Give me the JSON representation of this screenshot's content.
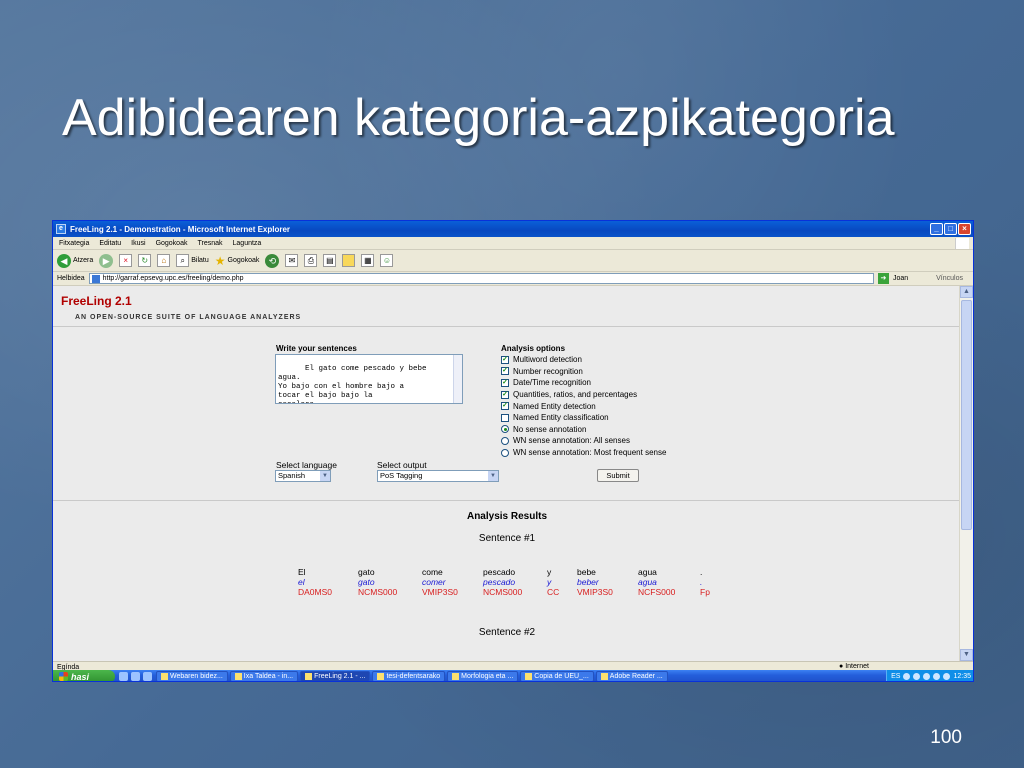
{
  "slide": {
    "title": "Adibidearen kategoria-azpikategoria",
    "number": "100"
  },
  "window": {
    "title": "FreeLing 2.1 - Demonstration - Microsoft Internet Explorer",
    "menu": [
      "Fitxategia",
      "Editatu",
      "Ikusi",
      "Gogokoak",
      "Tresnak",
      "Laguntza"
    ],
    "toolbar": {
      "back": "Atzera",
      "search": "Bilatu",
      "favorites": "Gogokoak"
    },
    "address": {
      "label": "Helbidea",
      "url": "http://garraf.epsevg.upc.es/freeling/demo.php",
      "go": "Joan",
      "links": "Vínculos"
    },
    "status": {
      "left": "Egínda",
      "zone": "Internet"
    }
  },
  "page": {
    "brand": "FreeLing 2.1",
    "subtitle": "AN OPEN-SOURCE SUITE OF LANGUAGE ANALYZERS",
    "sentences_label": "Write your sentences",
    "sentences_text": "El gato come pescado y bebe\nagua.\nYo bajo con el hombre bajo a\ntocar el bajo bajo la\nescalera.",
    "options_label": "Analysis options",
    "options": [
      {
        "type": "checkbox",
        "checked": true,
        "label": "Multiword detection"
      },
      {
        "type": "checkbox",
        "checked": true,
        "label": "Number recognition"
      },
      {
        "type": "checkbox",
        "checked": true,
        "label": "Date/Time recognition"
      },
      {
        "type": "checkbox",
        "checked": true,
        "label": "Quantities, ratios, and percentages"
      },
      {
        "type": "checkbox",
        "checked": true,
        "label": "Named Entity detection"
      },
      {
        "type": "checkbox",
        "checked": false,
        "label": "Named Entity classification"
      },
      {
        "type": "radio",
        "checked": true,
        "label": "No sense annotation"
      },
      {
        "type": "radio",
        "checked": false,
        "label": "WN sense annotation: All senses"
      },
      {
        "type": "radio",
        "checked": false,
        "label": "WN sense annotation: Most frequent sense"
      }
    ],
    "language_label": "Select language",
    "language_value": "Spanish",
    "output_label": "Select output",
    "output_value": "PoS Tagging",
    "submit_label": "Submit",
    "results_title": "Analysis Results",
    "sentence1_label": "Sentence #1",
    "sentence2_label": "Sentence #2",
    "tokens": [
      {
        "word": "El",
        "lemma": "el",
        "tag": "DA0MS0"
      },
      {
        "word": "gato",
        "lemma": "gato",
        "tag": "NCMS000"
      },
      {
        "word": "come",
        "lemma": "comer",
        "tag": "VMIP3S0"
      },
      {
        "word": "pescado",
        "lemma": "pescado",
        "tag": "NCMS000"
      },
      {
        "word": "y",
        "lemma": "y",
        "tag": "CC"
      },
      {
        "word": "bebe",
        "lemma": "beber",
        "tag": "VMIP3S0"
      },
      {
        "word": "agua",
        "lemma": "agua",
        "tag": "NCFS000"
      },
      {
        "word": ".",
        "lemma": ".",
        "tag": "Fp"
      }
    ]
  },
  "taskbar": {
    "start": "hasi",
    "tasks": [
      {
        "label": "Webaren bidez...",
        "active": false
      },
      {
        "label": "Ixa Taldea - in...",
        "active": false
      },
      {
        "label": "FreeLing 2.1 - ...",
        "active": true
      },
      {
        "label": "tesi-defentsarako",
        "active": false
      },
      {
        "label": "Morfologia eta ...",
        "active": false
      },
      {
        "label": "Copia de UEU_...",
        "active": false
      },
      {
        "label": "Adobe Reader ...",
        "active": false
      }
    ],
    "tray_lang": "ES",
    "clock": "12:35"
  }
}
